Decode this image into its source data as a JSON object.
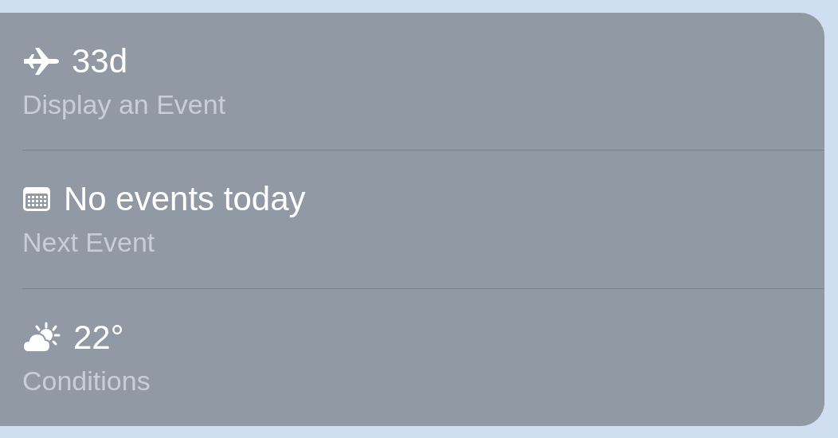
{
  "complications": [
    {
      "kind": "flight",
      "value": "33d",
      "label": "Display an Event"
    },
    {
      "kind": "calendar",
      "value": "No events today",
      "label": "Next Event"
    },
    {
      "kind": "weather",
      "value": "22°",
      "label": "Conditions"
    }
  ]
}
